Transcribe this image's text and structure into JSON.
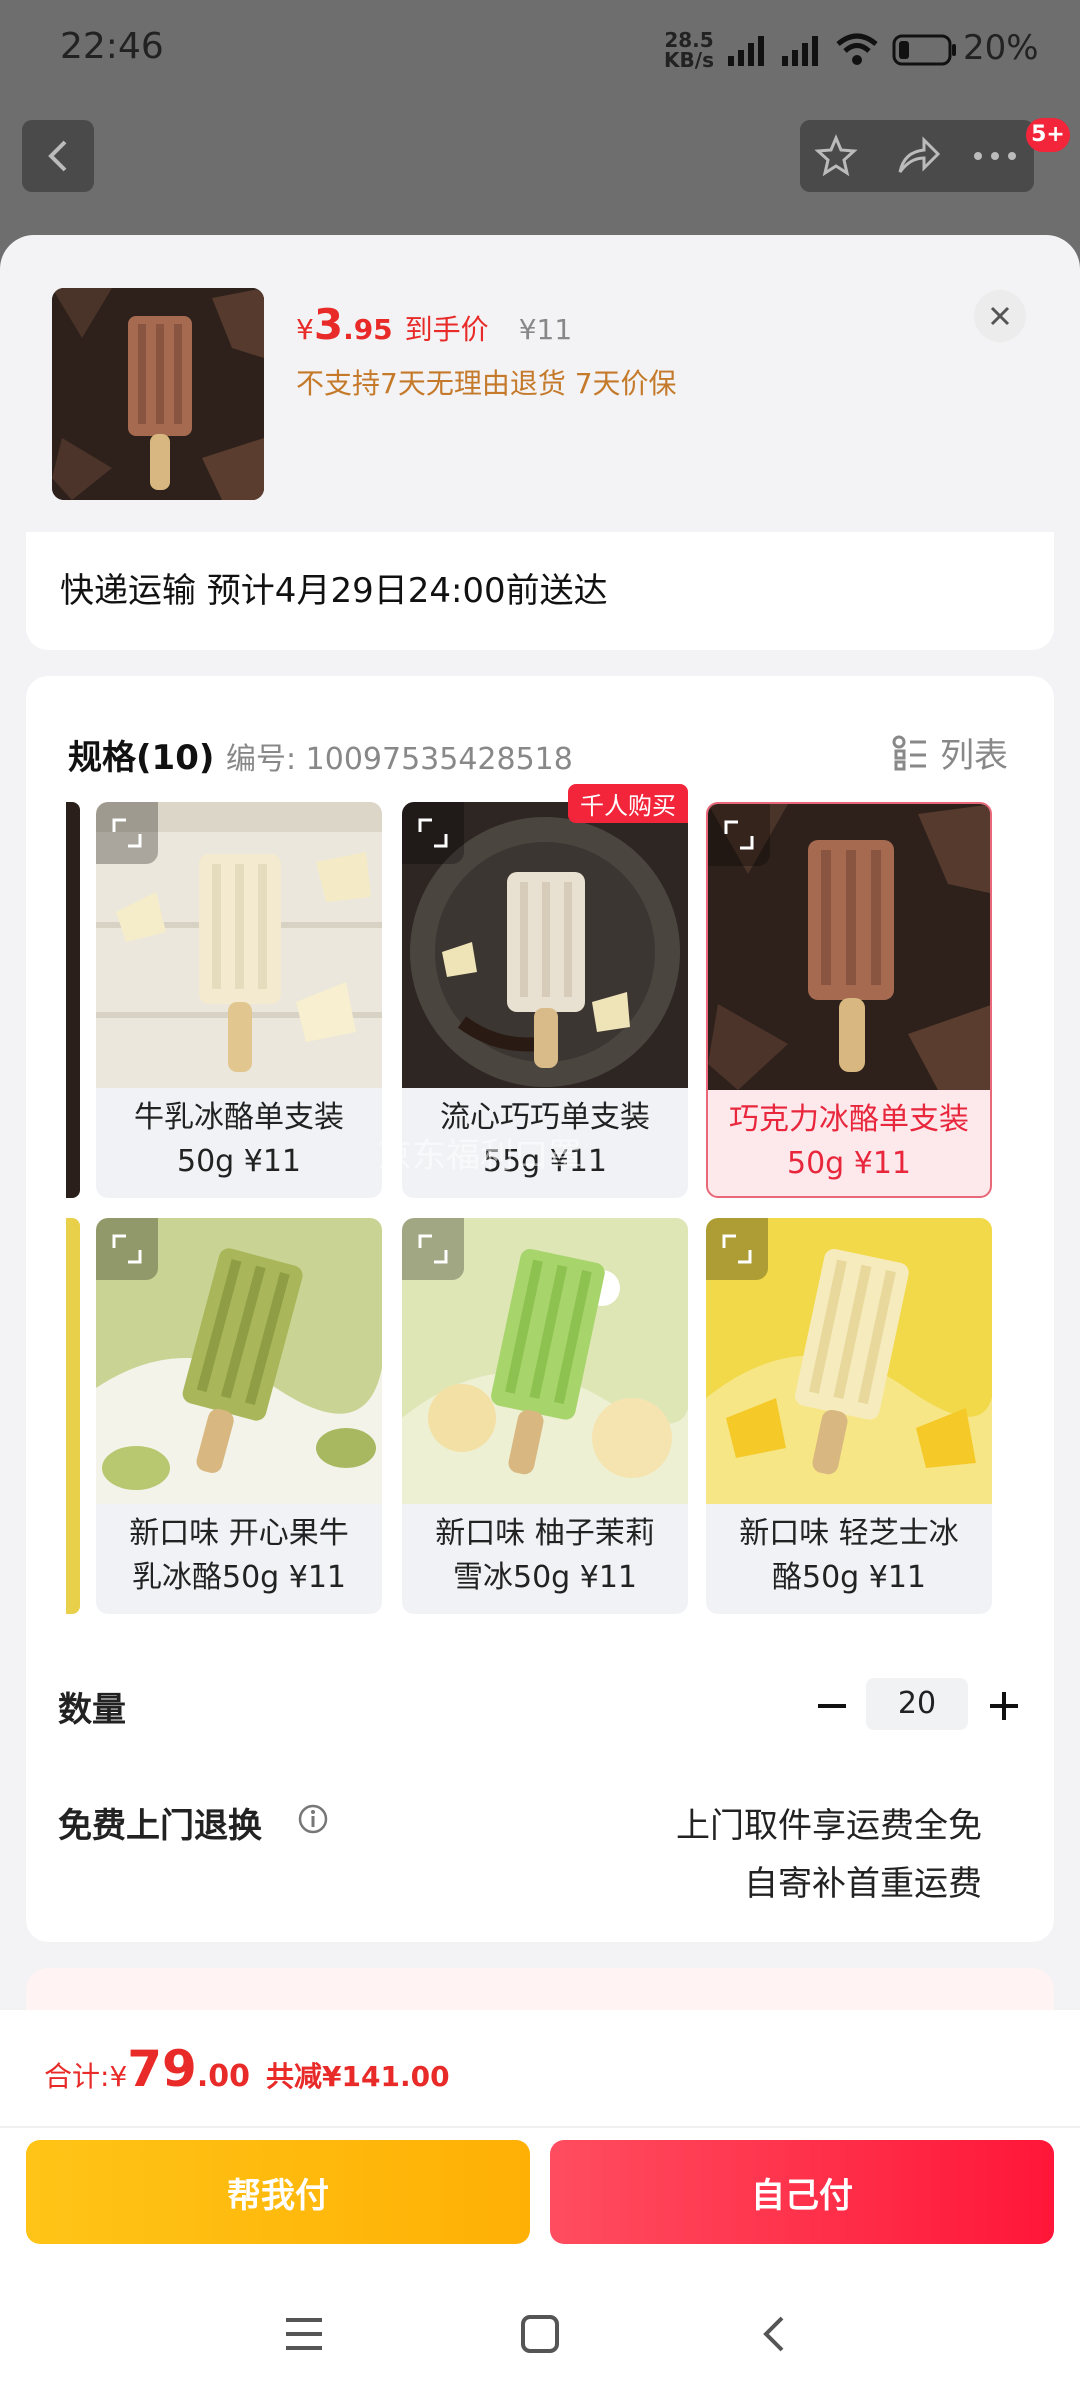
{
  "status_bar": {
    "time": "22:46",
    "net_speed_value": "28.5",
    "net_speed_unit": "KB/s",
    "battery": "20%"
  },
  "nav": {
    "badge": "5+"
  },
  "product": {
    "price_symbol": "¥",
    "price_int": "3",
    "price_dec": ".95",
    "price_label": "到手价",
    "orig_price": "¥11",
    "policy": "不支持7天无理由退货  7天价保"
  },
  "shipping": {
    "text": "快递运输  预计4月29日24:00前送达"
  },
  "spec": {
    "title": "规格(10)",
    "number": "编号: 10097535428518",
    "list_label": "列表",
    "items": [
      {
        "line1": "牛乳冰酪单支装",
        "line2": "50g ¥11",
        "tag": ""
      },
      {
        "line1": "流心巧巧单支装",
        "line2": "55g ¥11",
        "tag": "千人购买"
      },
      {
        "line1": "巧克力冰酪单支装",
        "line2": "50g ¥11",
        "tag": ""
      },
      {
        "line1": "新口味 开心果牛",
        "line2": "乳冰酪50g ¥11",
        "tag": ""
      },
      {
        "line1": "新口味 柚子茉莉",
        "line2": "雪冰50g ¥11",
        "tag": ""
      },
      {
        "line1": "新口味 轻芝士冰",
        "line2": "酪50g ¥11",
        "tag": ""
      }
    ],
    "watermark": "京东福利口罩"
  },
  "quantity": {
    "label": "数量",
    "value": "20"
  },
  "returns": {
    "label": "免费上门退换",
    "line1": "上门取件享运费全免",
    "line2": "自寄补首重运费"
  },
  "total": {
    "label": "合计: ",
    "symbol": "¥",
    "int": "79",
    "dec": ".00",
    "save": "共减¥141.00"
  },
  "buttons": {
    "help_pay": "帮我付",
    "self_pay": "自己付"
  },
  "colors": {
    "accent_red": "#e82a28",
    "button_yellow": "#ffb806",
    "button_red": "#ff2a46"
  }
}
